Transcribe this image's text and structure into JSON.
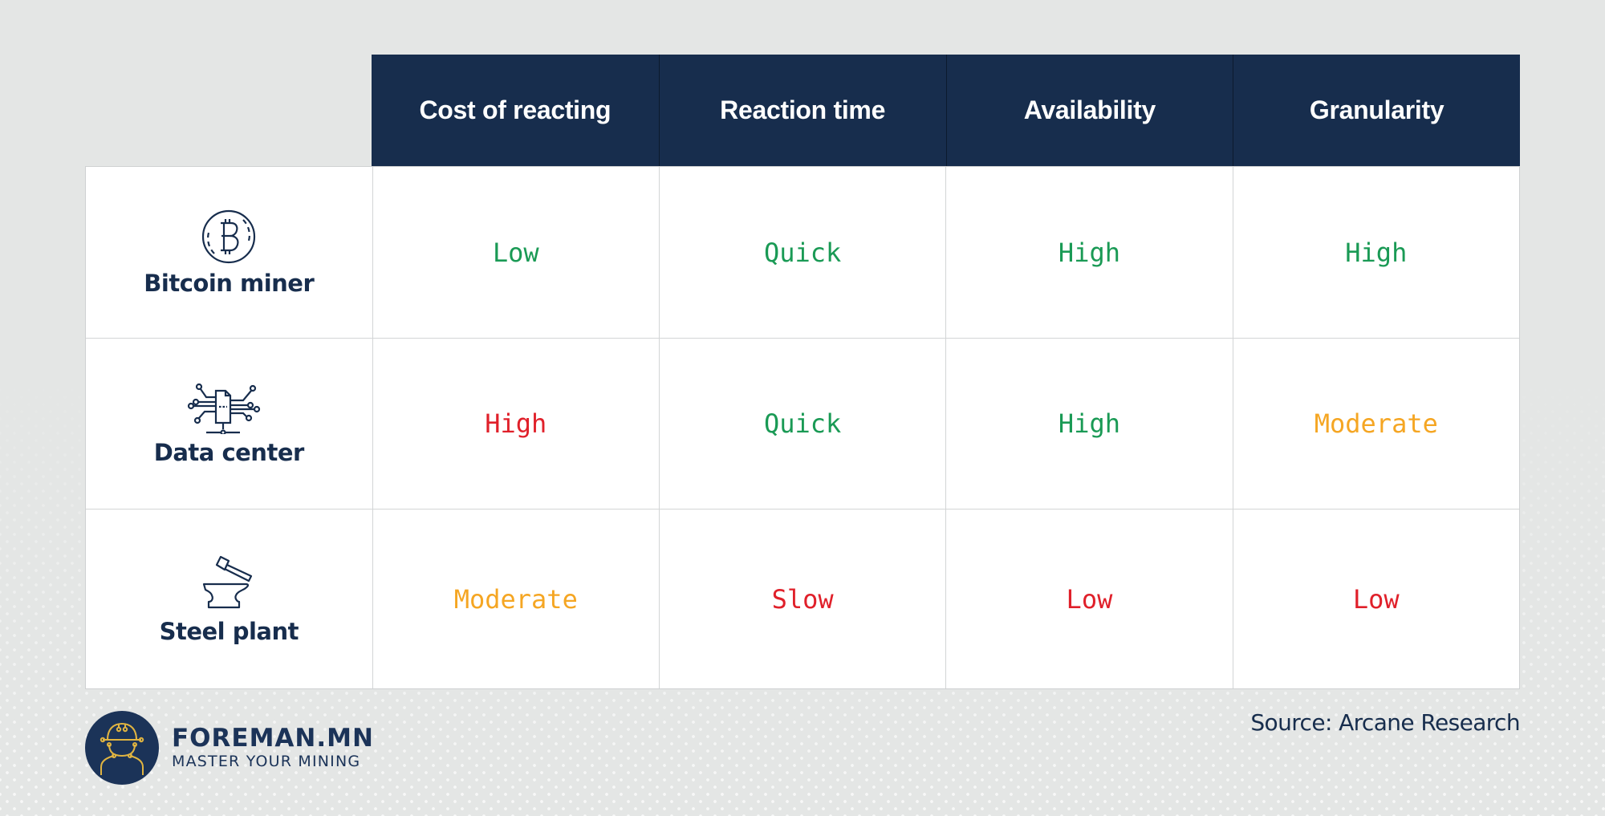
{
  "colors": {
    "header_bg": "#172d4d",
    "good": "#1a9a55",
    "bad": "#e0202a",
    "moderate": "#f5a623",
    "text_dark": "#172d4d"
  },
  "table": {
    "columns": [
      "Cost of reacting",
      "Reaction time",
      "Availability",
      "Granularity"
    ],
    "rows": [
      {
        "label": "Bitcoin miner",
        "icon": "bitcoin-icon",
        "values": [
          {
            "text": "Low",
            "rating": "good"
          },
          {
            "text": "Quick",
            "rating": "good"
          },
          {
            "text": "High",
            "rating": "good"
          },
          {
            "text": "High",
            "rating": "good"
          }
        ]
      },
      {
        "label": "Data center",
        "icon": "data-center-icon",
        "values": [
          {
            "text": "High",
            "rating": "bad"
          },
          {
            "text": "Quick",
            "rating": "good"
          },
          {
            "text": "High",
            "rating": "good"
          },
          {
            "text": "Moderate",
            "rating": "moderate"
          }
        ]
      },
      {
        "label": "Steel plant",
        "icon": "anvil-hammer-icon",
        "values": [
          {
            "text": "Moderate",
            "rating": "moderate"
          },
          {
            "text": "Slow",
            "rating": "bad"
          },
          {
            "text": "Low",
            "rating": "bad"
          },
          {
            "text": "Low",
            "rating": "bad"
          }
        ]
      }
    ]
  },
  "footer": {
    "brand_name": "FOREMAN.MN",
    "brand_tagline": "MASTER YOUR MINING",
    "logo_icon": "miner-helmet-icon",
    "source": "Source: Arcane Research"
  }
}
